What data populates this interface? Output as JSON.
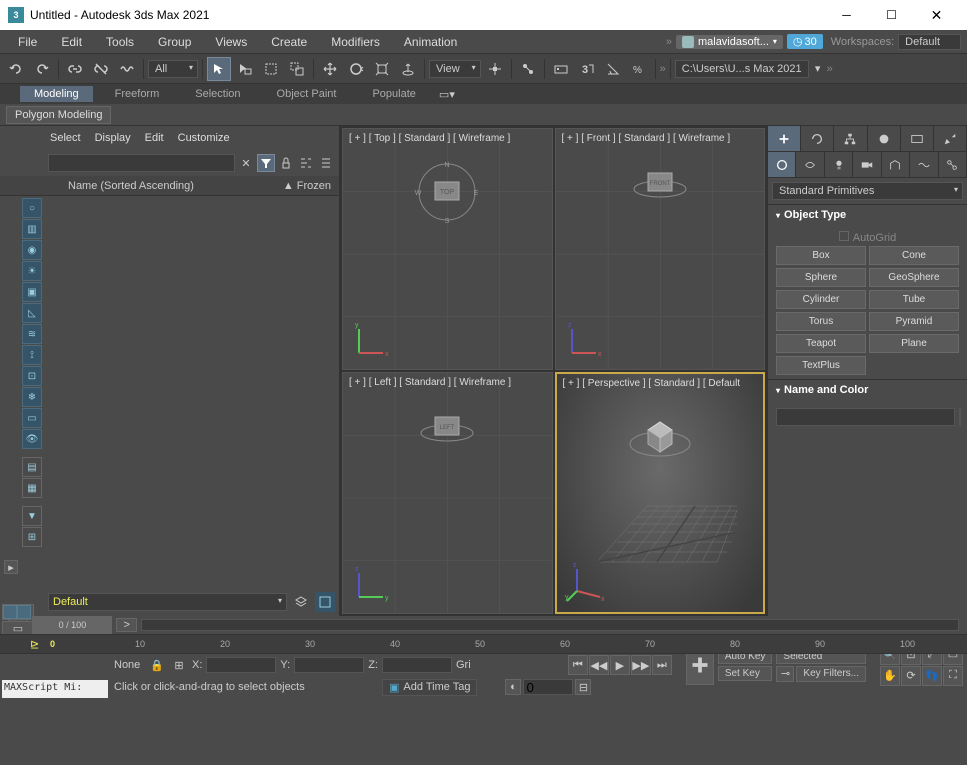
{
  "window": {
    "title": "Untitled - Autodesk 3ds Max 2021",
    "app_icon_text": "3"
  },
  "menubar": {
    "items": [
      "File",
      "Edit",
      "Tools",
      "Group",
      "Views",
      "Create",
      "Modifiers",
      "Animation"
    ],
    "user": "malavidasoft...",
    "time_value": "30",
    "workspaces_label": "Workspaces:",
    "workspace": "Default"
  },
  "toolbar": {
    "selection_filter": "All",
    "view_label": "View",
    "path": "C:\\Users\\U...s Max 2021"
  },
  "ribbon": {
    "tabs": [
      "Modeling",
      "Freeform",
      "Selection",
      "Object Paint",
      "Populate"
    ],
    "active_tab": 0,
    "sub_item": "Polygon Modeling"
  },
  "scene_explorer": {
    "menu": [
      "Select",
      "Display",
      "Edit",
      "Customize"
    ],
    "col_name": "Name (Sorted Ascending)",
    "col_frozen": "▲ Frozen",
    "layer_set": "Default"
  },
  "viewports": {
    "tl": "[ + ] [ Top ] [ Standard ] [ Wireframe ]",
    "tr": "[ + ] [ Front ] [ Standard ] [ Wireframe ]",
    "bl": "[ + ] [ Left ] [ Standard ] [ Wireframe ]",
    "br": "[ + ] [ Perspective ] [ Standard ] [ Default",
    "cube_top": "TOP",
    "cube_front": "FRONT",
    "cube_left": "LEFT",
    "compass": {
      "n": "N",
      "s": "S",
      "e": "E",
      "w": "W"
    }
  },
  "command_panel": {
    "category": "Standard Primitives",
    "rollout_objtype": "Object Type",
    "autogrid": "AutoGrid",
    "primitives": [
      "Box",
      "Cone",
      "Sphere",
      "GeoSphere",
      "Cylinder",
      "Tube",
      "Torus",
      "Pyramid",
      "Teapot",
      "Plane",
      "TextPlus"
    ],
    "rollout_namecolor": "Name and Color",
    "color": "#e646c4"
  },
  "timeline": {
    "slider_label": "0 / 100",
    "ticks": [
      0,
      10,
      20,
      30,
      40,
      50,
      60,
      70,
      80,
      90,
      100
    ]
  },
  "status": {
    "none_label": "None",
    "x_label": "X:",
    "y_label": "Y:",
    "z_label": "Z:",
    "grid_label": "Gri",
    "prompt": "Click or click-and-drag to select objects",
    "add_time_tag": "Add Time Tag",
    "frame_value": "0",
    "auto_key": "Auto Key",
    "set_key": "Set Key",
    "selected": "Selected",
    "key_filters": "Key Filters...",
    "maxscript": "MAXScript Mi:"
  }
}
